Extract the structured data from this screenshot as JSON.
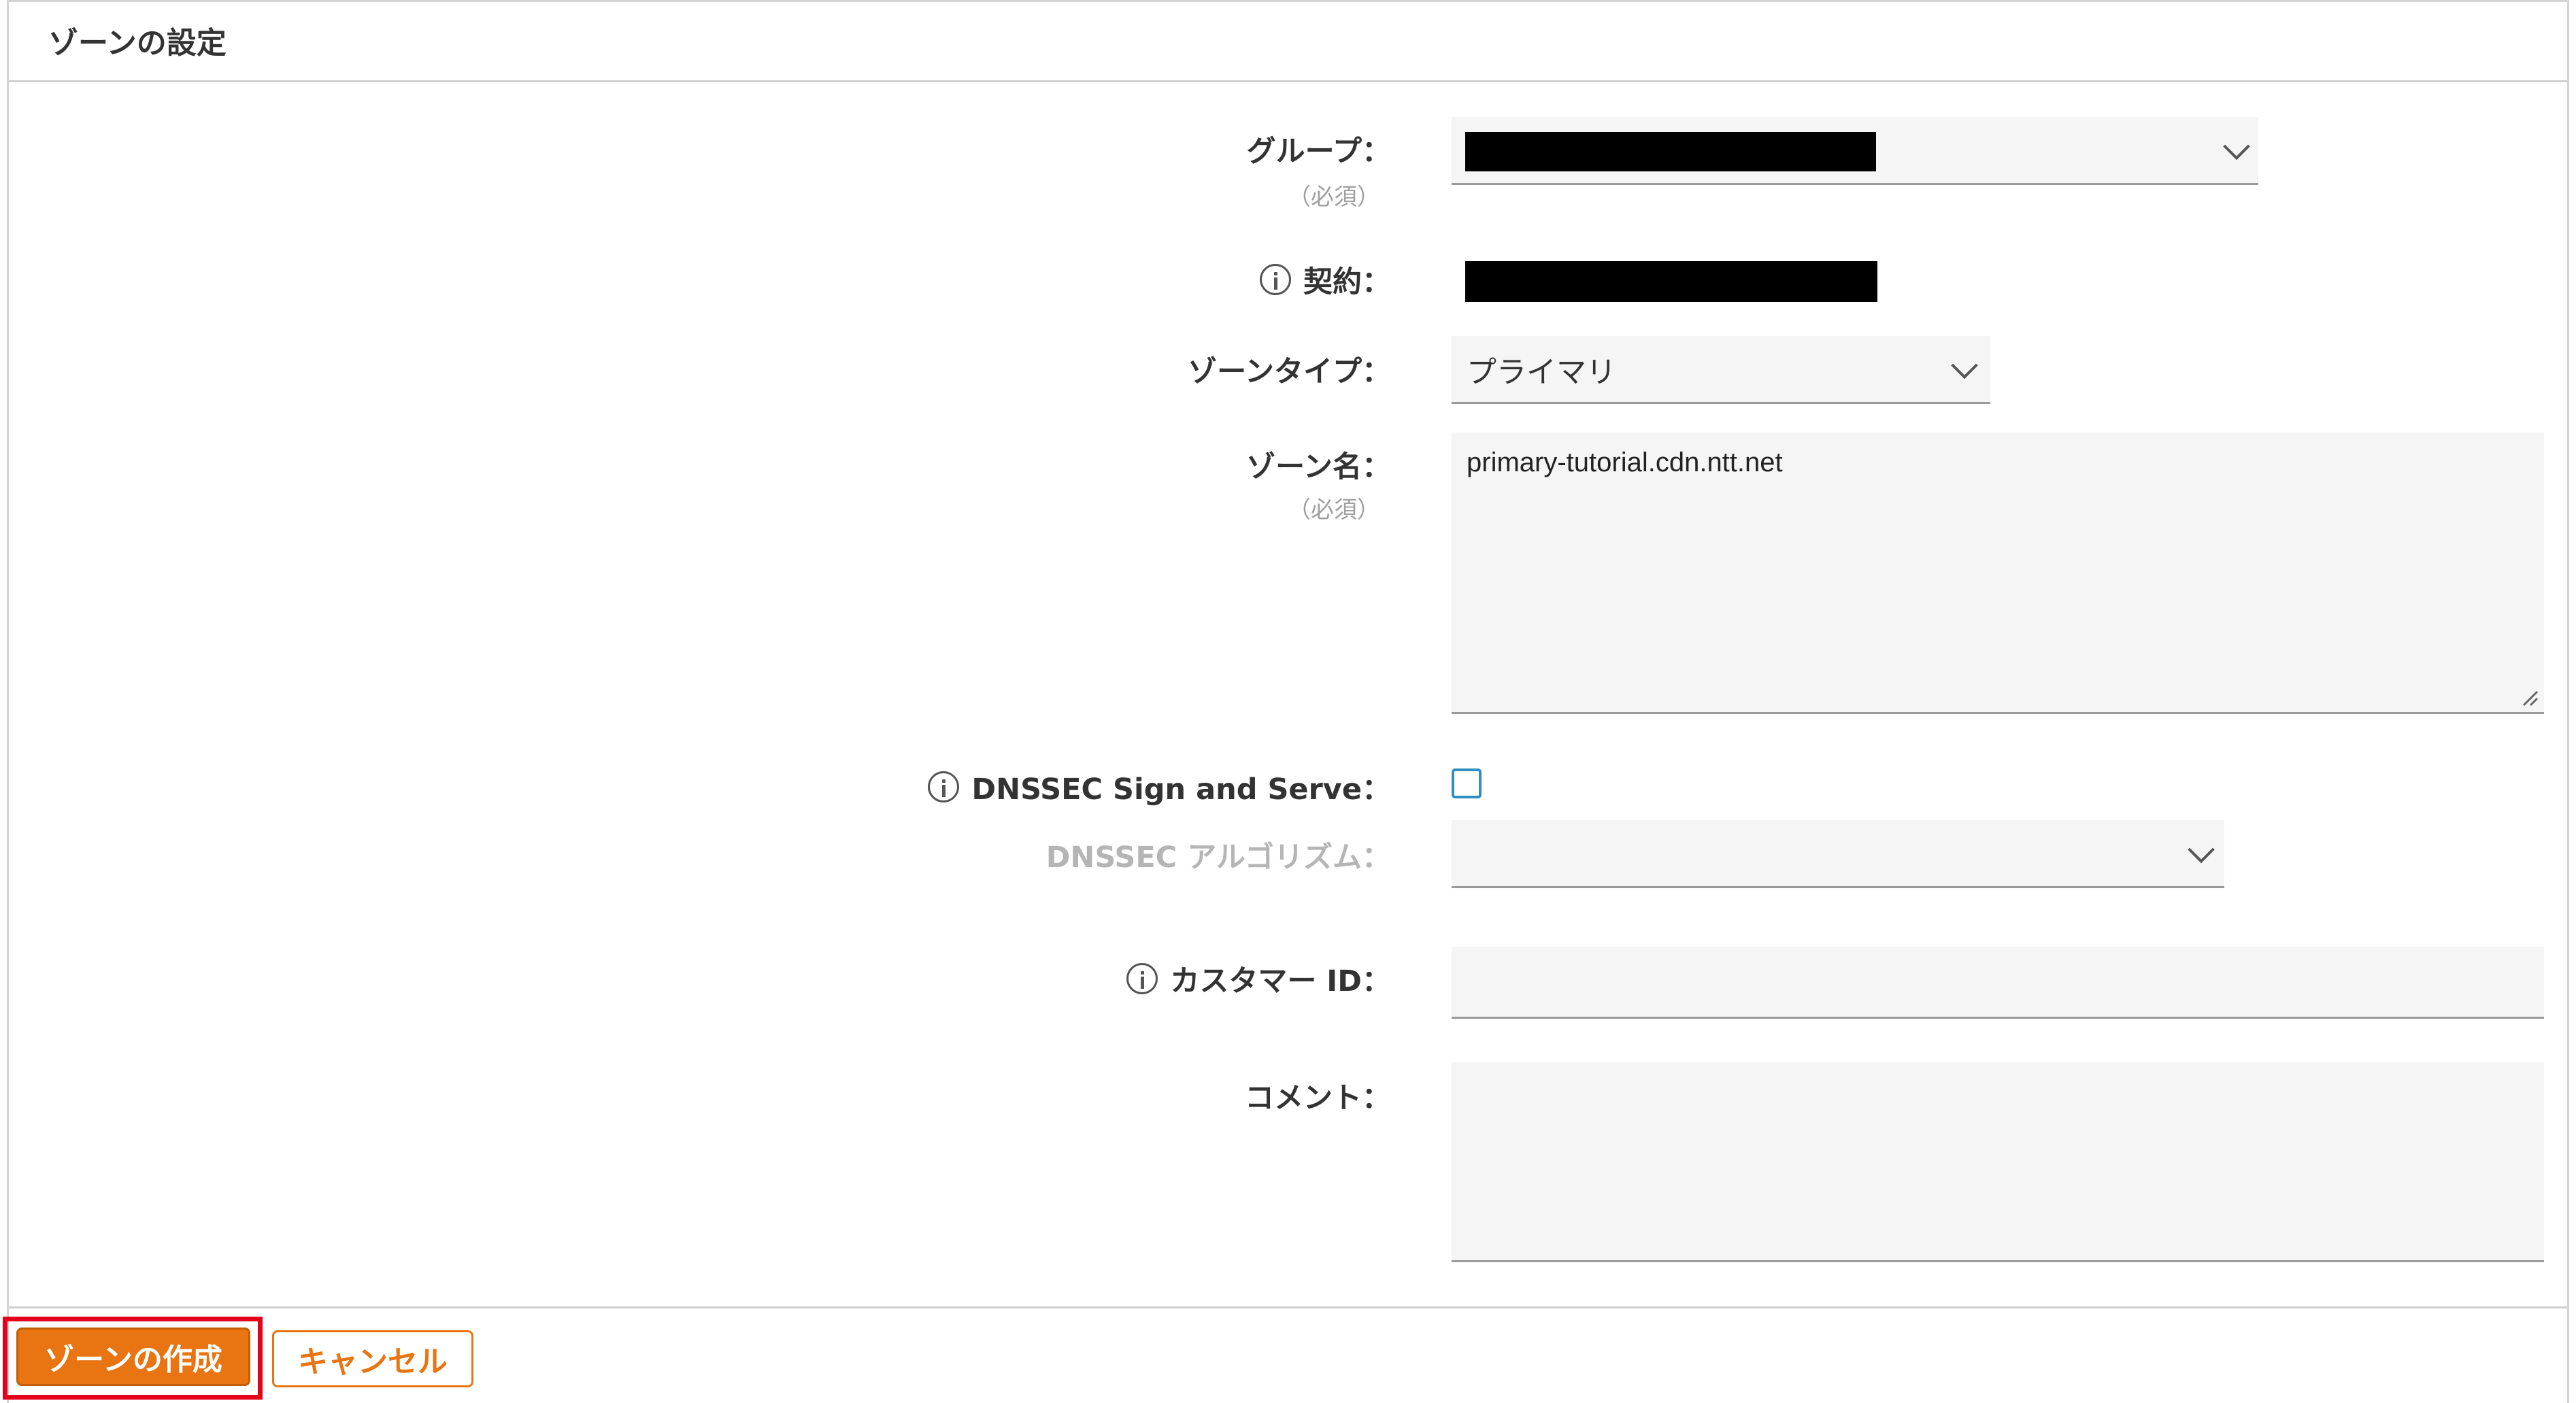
{
  "panel": {
    "title": "ゾーンの設定"
  },
  "form": {
    "group": {
      "label": "グループ：",
      "required": "（必須）"
    },
    "contract": {
      "label": "契約："
    },
    "zone_type": {
      "label": "ゾーンタイプ：",
      "value": "プライマリ"
    },
    "zone_name": {
      "label": "ゾーン名：",
      "required": "（必須）",
      "value": "primary-tutorial.cdn.ntt.net"
    },
    "dnssec": {
      "label": "DNSSEC Sign and Serve：",
      "checked": false
    },
    "dnssec_algorithm": {
      "label": "DNSSEC アルゴリズム：",
      "value": ""
    },
    "customer_id": {
      "label": "カスタマー ID：",
      "value": ""
    },
    "comment": {
      "label": "コメント：",
      "value": ""
    }
  },
  "actions": {
    "create_label": "ゾーンの作成",
    "cancel_label": "キャンセル"
  },
  "icons": {
    "info": "info-icon",
    "dropdown": "chevron-down-icon",
    "resize": "resize-grip-icon"
  },
  "colors": {
    "accent": "#e87511",
    "highlight": "#e5001c",
    "checkbox": "#2f8fc4"
  }
}
